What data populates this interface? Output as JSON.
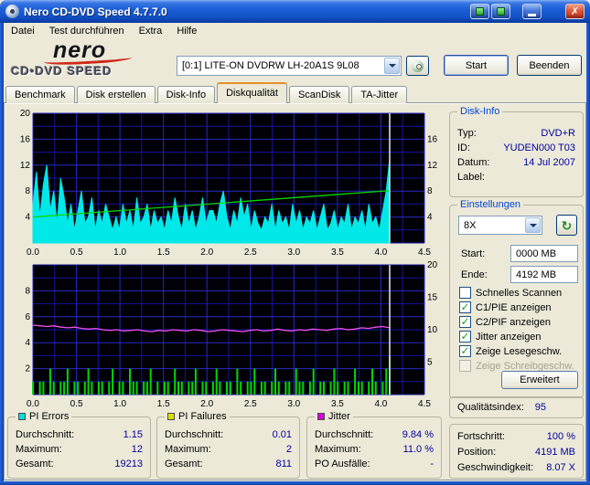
{
  "window": {
    "title": "Nero CD-DVD Speed 4.7.7.0"
  },
  "menu": {
    "items": [
      "Datei",
      "Test durchführen",
      "Extra",
      "Hilfe"
    ]
  },
  "header": {
    "logo_top": "nero",
    "logo_bottom": "CD•DVD SPEED",
    "drive": "[0:1]  LITE-ON DVDRW LH-20A1S 9L08",
    "start": "Start",
    "quit": "Beenden"
  },
  "tabs": {
    "items": [
      {
        "label": "Benchmark",
        "active": false
      },
      {
        "label": "Disk erstellen",
        "active": false
      },
      {
        "label": "Disk-Info",
        "active": false
      },
      {
        "label": "Diskqualität",
        "active": true
      },
      {
        "label": "ScanDisk",
        "active": false
      },
      {
        "label": "TA-Jitter",
        "active": false
      }
    ]
  },
  "disk_info": {
    "title": "Disk-Info",
    "rows": [
      {
        "label": "Typ:",
        "value": "DVD+R"
      },
      {
        "label": "ID:",
        "value": "YUDEN000 T03"
      },
      {
        "label": "Datum:",
        "value": "14 Jul 2007"
      },
      {
        "label": "Label:",
        "value": ""
      }
    ]
  },
  "settings": {
    "title": "Einstellungen",
    "speed": "8X",
    "start_label": "Start:",
    "start_value": "0000 MB",
    "end_label": "Ende:",
    "end_value": "4192 MB",
    "checkboxes": [
      {
        "label": "Schnelles Scannen",
        "checked": false,
        "disabled": false
      },
      {
        "label": "C1/PIE anzeigen",
        "checked": true,
        "disabled": false
      },
      {
        "label": "C2/PIF anzeigen",
        "checked": true,
        "disabled": false
      },
      {
        "label": "Jitter anzeigen",
        "checked": true,
        "disabled": false
      },
      {
        "label": "Zeige Lesegeschw.",
        "checked": true,
        "disabled": false
      },
      {
        "label": "Zeige Schreibgeschw.",
        "checked": false,
        "disabled": true
      }
    ],
    "advanced": "Erweitert"
  },
  "quality": {
    "label": "Qualitätsindex:",
    "value": "95"
  },
  "status": {
    "rows": [
      {
        "label": "Fortschritt:",
        "value": "100 %"
      },
      {
        "label": "Position:",
        "value": "4191 MB"
      },
      {
        "label": "Geschwindigkeit:",
        "value": "8.07 X"
      }
    ]
  },
  "stats": [
    {
      "title": "PI Errors",
      "color": "#00dede",
      "rows": [
        {
          "label": "Durchschnitt:",
          "value": "1.15"
        },
        {
          "label": "Maximum:",
          "value": "12"
        },
        {
          "label": "Gesamt:",
          "value": "19213"
        }
      ]
    },
    {
      "title": "PI Failures",
      "color": "#dede00",
      "rows": [
        {
          "label": "Durchschnitt:",
          "value": "0.01"
        },
        {
          "label": "Maximum:",
          "value": "2"
        },
        {
          "label": "Gesamt:",
          "value": "811"
        }
      ]
    },
    {
      "title": "Jitter",
      "color": "#de00de",
      "rows": [
        {
          "label": "Durchschnitt:",
          "value": "9.84 %"
        },
        {
          "label": "Maximum:",
          "value": "11.0 %"
        },
        {
          "label": "PO Ausfälle:",
          "value": "-"
        }
      ]
    }
  ],
  "chart_data": [
    {
      "type": "area",
      "title": "",
      "x_range": [
        0,
        4.5
      ],
      "x_tick_step": 0.5,
      "grid": true,
      "y_left": {
        "min": 0,
        "max": 20,
        "ticks": [
          4,
          8,
          12,
          16,
          20
        ],
        "grid_step": 2
      },
      "y_right": {
        "min": 0,
        "max": 20,
        "ticks": [
          4,
          8,
          12,
          16
        ]
      },
      "series": [
        {
          "name": "PI Errors",
          "type": "area",
          "axis": "left",
          "color": "#00e8e8",
          "x_end": 4.1,
          "values": [
            6,
            11,
            4,
            9,
            12,
            5,
            8,
            3,
            10,
            7,
            3,
            6,
            2,
            5,
            8,
            3,
            4,
            7,
            2,
            5,
            3,
            6,
            4,
            2,
            4,
            2,
            6,
            3,
            5,
            2,
            7,
            3,
            4,
            6,
            2,
            5,
            3,
            4,
            2,
            5,
            3,
            7,
            4,
            2,
            6,
            3,
            5,
            2,
            4,
            7,
            3,
            5,
            5,
            3,
            6,
            8,
            4,
            2,
            5,
            3,
            7,
            4,
            6,
            2,
            5,
            3,
            2,
            4,
            3,
            6,
            2,
            5,
            3,
            4,
            2,
            6,
            3,
            5,
            2,
            4,
            3,
            5,
            2,
            4,
            6,
            2,
            3,
            5,
            2,
            4,
            3,
            6,
            2,
            4,
            3,
            5,
            2,
            6,
            3,
            4,
            2,
            5,
            8,
            13
          ]
        },
        {
          "name": "Lesegeschwindigkeit",
          "type": "line",
          "axis": "right",
          "color": "#00d800",
          "x": [
            0,
            4.1
          ],
          "values": [
            4.0,
            8.07
          ]
        },
        {
          "name": "Scan-Ende",
          "type": "vline",
          "color": "#dcdcdc",
          "x": 4.1
        }
      ]
    },
    {
      "type": "line",
      "title": "",
      "x_range": [
        0,
        4.5
      ],
      "x_tick_step": 0.5,
      "grid": true,
      "y_left": {
        "min": 0,
        "max": 10,
        "ticks": [
          2,
          4,
          6,
          8
        ],
        "grid_step": 1
      },
      "y_right": {
        "min": 0,
        "max": 20,
        "ticks": [
          5,
          10,
          15,
          20
        ]
      },
      "series": [
        {
          "name": "PI Failures",
          "type": "bars",
          "axis": "left",
          "color": "#00d800",
          "x_end": 4.1,
          "values": [
            1,
            0,
            1,
            1,
            0,
            2,
            1,
            0,
            1,
            1,
            2,
            0,
            1,
            1,
            0,
            1,
            2,
            1,
            0,
            1,
            1,
            0,
            1,
            2,
            0,
            1,
            1,
            0,
            2,
            1,
            1,
            0,
            1,
            1,
            2,
            0,
            1,
            0,
            1,
            1,
            0,
            2,
            1,
            1,
            0,
            1,
            1,
            2,
            0,
            1,
            1,
            0,
            1,
            2,
            1,
            0,
            1,
            1,
            0,
            2,
            1,
            0,
            1,
            1,
            2,
            0,
            1,
            1,
            0,
            1,
            2,
            1,
            0,
            1,
            1,
            0,
            2,
            1,
            1,
            0,
            1,
            2,
            0,
            1,
            1,
            0,
            1,
            2,
            1,
            0,
            1,
            1,
            0,
            2,
            1,
            1,
            0,
            1,
            2,
            1,
            0,
            1,
            2,
            3
          ]
        },
        {
          "name": "Jitter",
          "type": "line",
          "axis": "right",
          "color": "#f050f0",
          "x_end": 4.1,
          "values": [
            10.7,
            10.6,
            10.5,
            10.6,
            10.4,
            10.3,
            10.4,
            10.2,
            10.1,
            10.2,
            10.0,
            9.9,
            10.0,
            9.8,
            9.9,
            10.0,
            9.8,
            9.7,
            9.9,
            9.8,
            10.0,
            9.9,
            9.8,
            10.0,
            9.9,
            9.7,
            9.8,
            10.0,
            9.9,
            9.8,
            9.7,
            9.9,
            10.0,
            9.8,
            9.9,
            10.1,
            9.9,
            9.8,
            10.0,
            9.9,
            10.1,
            10.0,
            9.9,
            10.1,
            10.2,
            10.0,
            10.1,
            10.3,
            10.2,
            10.4,
            10.5,
            10.3
          ]
        },
        {
          "name": "Scan-Ende",
          "type": "vline",
          "color": "#dcdcdc",
          "x": 4.1
        }
      ]
    }
  ]
}
